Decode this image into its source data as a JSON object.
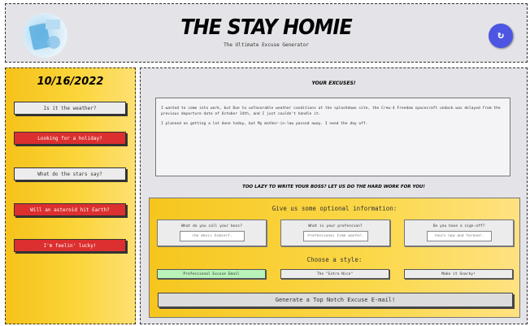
{
  "header": {
    "title": "THE STAY HOMIE",
    "subtitle": "The Ultimate Excuse Generator",
    "refresh_icon": "refresh-icon",
    "refresh_color": "#4c56e2"
  },
  "sidebar": {
    "date": "10/16/2022",
    "buttons": [
      {
        "label": "Is it the weather?",
        "style": "gray"
      },
      {
        "label": "Looking for a holiday?",
        "style": "red"
      },
      {
        "label": "What do the stars say?",
        "style": "gray"
      },
      {
        "label": "Will an asteroid hit Earth?",
        "style": "red"
      },
      {
        "label": "I'm feelin' lucky!",
        "style": "red"
      }
    ]
  },
  "main": {
    "excuses_heading": "YOUR EXCUSES!",
    "excuses": [
      "I wanted to come into work, but Due to unfavorable weather conditions at the splashdown site, the Crew-4 Freedom spacecraft undock was delayed from the previous departure date of October 14th, and I just couldn't handle it.",
      "I planned on getting a lot done today, but My mother-in-law passed away. I need the day off."
    ],
    "lazy_heading": "TOO LAZY TO WRITE YOUR BOSS? LET US DO THE HARD WORK FOR YOU!",
    "options": {
      "heading": "Give us some optional information:",
      "questions": [
        {
          "label": "What do you call your boss?",
          "placeholder": "The devil himself."
        },
        {
          "label": "What is your profession?",
          "placeholder": "Professional time waster."
        },
        {
          "label": "Do you have a sign-off?",
          "placeholder": "Yours now and forever."
        }
      ],
      "style_heading": "Choose a style:",
      "styles": [
        {
          "label": "Professional Excuse Email",
          "active": true
        },
        {
          "label": "The \"Extra Nice\"",
          "active": false
        },
        {
          "label": "Make it Snarky!",
          "active": false
        }
      ],
      "generate_label": "Generate a Top Notch Excuse E-mail!"
    }
  },
  "colors": {
    "accent_yellow": "#f5c21a",
    "button_red": "#dc2f2f",
    "active_green": "#b9f3b9",
    "panel_gray": "#e4e4e8"
  }
}
